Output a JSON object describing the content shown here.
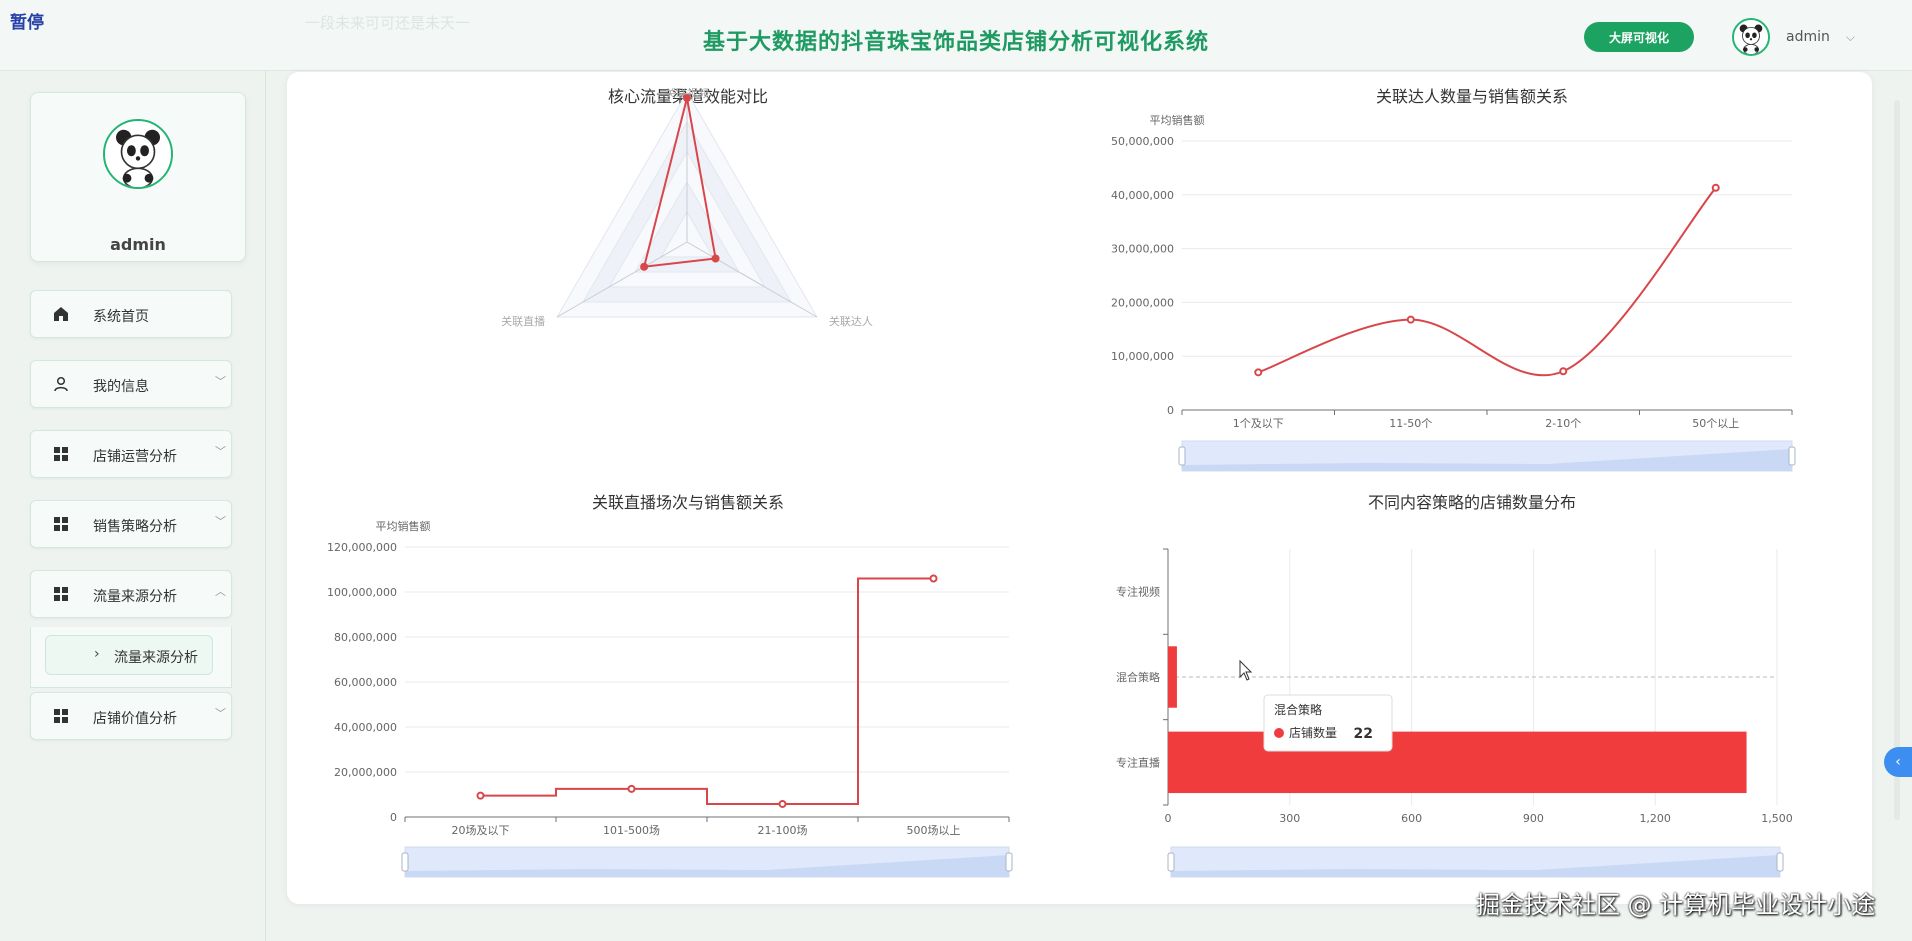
{
  "header": {
    "pause_label": "暂停",
    "faint_title": "一段未来可可还是未天一",
    "title": "基于大数据的抖音珠宝饰品类店铺分析可视化系统",
    "bigscreen_button": "大屏可视化",
    "username": "admin",
    "user_menu_icon": "chevron-down-icon"
  },
  "sidebar": {
    "profile_name": "admin",
    "menu": [
      {
        "label": "系统首页",
        "icon": "home-icon",
        "chevron": ""
      },
      {
        "label": "我的信息",
        "icon": "user-icon",
        "chevron": "﹀"
      },
      {
        "label": "店铺运营分析",
        "icon": "grid-icon",
        "chevron": "﹀"
      },
      {
        "label": "销售策略分析",
        "icon": "grid-icon",
        "chevron": "﹀"
      },
      {
        "label": "流量来源分析",
        "icon": "grid-icon",
        "chevron": "︿"
      },
      {
        "label": "店铺价值分析",
        "icon": "grid-icon",
        "chevron": "﹀"
      }
    ],
    "submenu": {
      "label": "流量来源分析",
      "icon": "chevron-right-icon"
    }
  },
  "chart_data": [
    {
      "type": "radar",
      "title": "核心流量渠道效能对比",
      "indicators": [
        "关联视频",
        "关联达人",
        "关联直播"
      ],
      "values": [
        0.96,
        0.22,
        0.33
      ],
      "color": "#d9464a"
    },
    {
      "type": "line",
      "title": "关联达人数量与销售额关系",
      "ylabel": "平均销售额",
      "categories": [
        "1个及以下",
        "11-50个",
        "2-10个",
        "50个以上"
      ],
      "values": [
        7000000,
        16800000,
        7200000,
        41300000
      ],
      "ylim": [
        0,
        50000000
      ],
      "yticks": [
        "0",
        "10,000,000",
        "20,000,000",
        "30,000,000",
        "40,000,000",
        "50,000,000"
      ],
      "smooth": true,
      "color": "#d9464a",
      "datazoom": true
    },
    {
      "type": "line",
      "title": "关联直播场次与销售额关系",
      "ylabel": "平均销售额",
      "categories": [
        "20场及以下",
        "101-500场",
        "21-100场",
        "500场以上"
      ],
      "values": [
        9500000,
        12500000,
        5800000,
        106000000
      ],
      "ylim": [
        0,
        120000000
      ],
      "yticks": [
        "0",
        "20,000,000",
        "40,000,000",
        "60,000,000",
        "80,000,000",
        "100,000,000",
        "120,000,000"
      ],
      "step": true,
      "color": "#d9464a",
      "datazoom": true
    },
    {
      "type": "bar",
      "orientation": "horizontal",
      "title": "不同内容策略的店铺数量分布",
      "categories": [
        "专注直播",
        "混合策略",
        "专注视频"
      ],
      "series": [
        {
          "name": "店铺数量",
          "values": [
            1425,
            22,
            0
          ]
        }
      ],
      "xlim": [
        0,
        1500
      ],
      "xticks": [
        "0",
        "300",
        "600",
        "900",
        "1,200",
        "1,500"
      ],
      "color": "#f03c3c",
      "datazoom": true,
      "tooltip": {
        "title": "混合策略",
        "label": "店铺数量",
        "value": "22"
      }
    }
  ],
  "watermark": "掘金技术社区 @ 计算机毕业设计小途",
  "scroll_tab_icon": "chevron-left-icon"
}
